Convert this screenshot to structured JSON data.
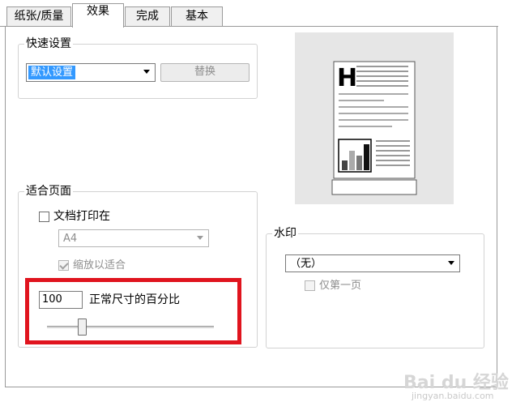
{
  "tabs": [
    {
      "label": "纸张/质量"
    },
    {
      "label": "效果"
    },
    {
      "label": "完成"
    },
    {
      "label": "基本"
    }
  ],
  "quick_settings": {
    "title": "快速设置",
    "preset_value": "默认设置",
    "replace_label": "替换"
  },
  "fit_page": {
    "title": "适合页面",
    "print_on_label": "文档打印在",
    "paper_value": "A4",
    "scale_label": "缩放以适合",
    "percent_value": "100",
    "percent_label": "正常尺寸的百分比",
    "slider_percent": 100
  },
  "watermark": {
    "title": "水印",
    "value": "（无）",
    "first_page_label": "仅第一页"
  },
  "preview": {
    "icon": "document-preview-icon",
    "heading_glyph": "H"
  },
  "site_watermark": {
    "logo": "Bai du 经验",
    "url": "jingyan.baidu.com"
  },
  "colors": {
    "highlight": "#e0141e",
    "selection": "#3399ff"
  }
}
